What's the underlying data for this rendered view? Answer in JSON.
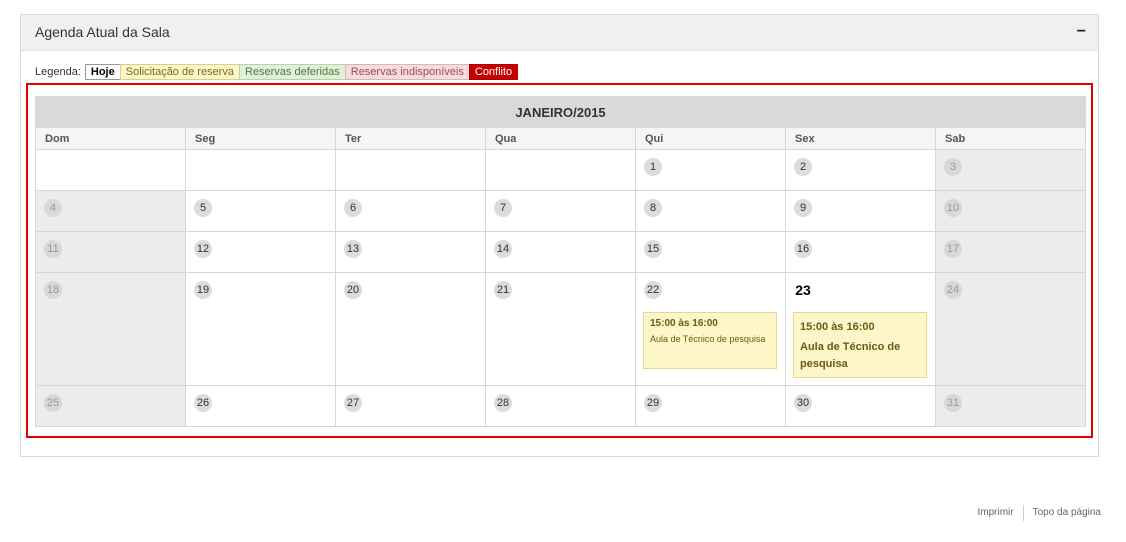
{
  "panel": {
    "title": "Agenda Atual da Sala",
    "collapse_label": "−"
  },
  "legend": {
    "label": "Legenda:",
    "items": [
      "Hoje",
      "Solicitação de reserva",
      "Reservas deferidas",
      "Reservas indisponíveis",
      "Conflito"
    ]
  },
  "calendar": {
    "month": "JANEIRO/2015",
    "weekdays": [
      "Dom",
      "Seg",
      "Ter",
      "Qua",
      "Qui",
      "Sex",
      "Sab"
    ],
    "days": [
      "1",
      "2",
      "3",
      "4",
      "5",
      "6",
      "7",
      "8",
      "9",
      "10",
      "11",
      "12",
      "13",
      "14",
      "15",
      "16",
      "17",
      "18",
      "19",
      "20",
      "21",
      "22",
      "23",
      "24",
      "25",
      "26",
      "27",
      "28",
      "29",
      "30",
      "31"
    ],
    "events": [
      {
        "day": "22",
        "time": "15:00 às 16:00",
        "title": "Aula de Técnico de pesquisa"
      },
      {
        "day": "23",
        "time": "15:00 às 16:00",
        "title": "Aula de Técnico de pesquisa"
      }
    ]
  },
  "footer": {
    "print": "Imprimir",
    "top": "Topo da página"
  },
  "colors": {
    "today_border": "#999999",
    "request": "#fdf6c8",
    "approved": "#e1f0da",
    "unavailable": "#f6dcdc",
    "conflict": "#c40000",
    "highlight": "#e00000"
  }
}
